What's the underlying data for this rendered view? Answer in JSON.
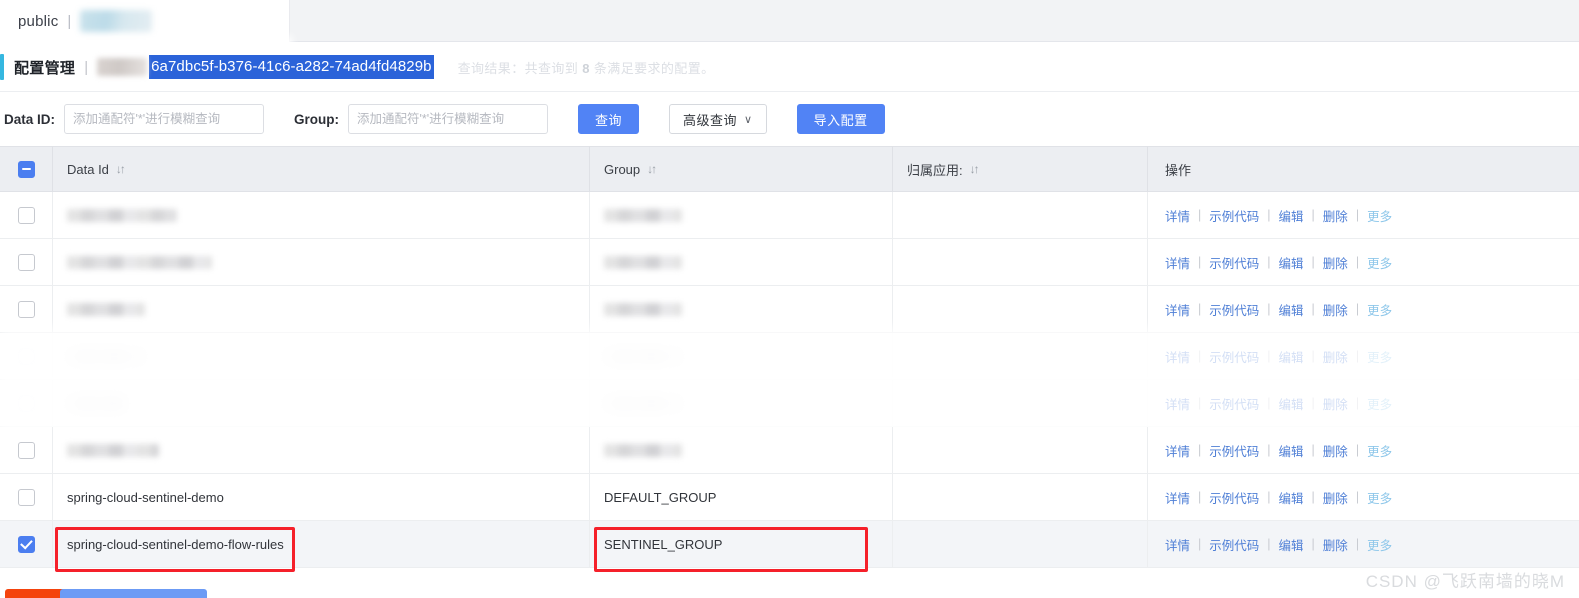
{
  "tab": {
    "namespace_label": "public",
    "separator": "|",
    "redacted_icon": "blurred-namespace-chip"
  },
  "header": {
    "title": "配置管理",
    "separator": "|",
    "redacted_prefix": "blurred-tenant-name",
    "selected_namespace_id": "6a7dbc5f-b376-41c6-a282-74ad4fd4829b",
    "query_result_prefix": "查询结果：共查询到",
    "query_result_count": "8",
    "query_result_suffix": "条满足要求的配置。",
    "accent_color": "#35b7e0",
    "selection_color": "#2b63d9"
  },
  "search": {
    "data_id_label": "Data ID:",
    "data_id_value": "",
    "data_id_placeholder": "添加通配符'*'进行模糊查询",
    "group_label": "Group:",
    "group_value": "",
    "group_placeholder": "添加通配符'*'进行模糊查询",
    "query_button": "查询",
    "advanced_button": "高级查询",
    "advanced_caret": "∨",
    "import_button": "导入配置",
    "primary_color": "#5183f5"
  },
  "table": {
    "columns": [
      {
        "label": "Data Id",
        "sort": "↓↑"
      },
      {
        "label": "Group",
        "sort": "↓↑"
      },
      {
        "label": "归属应用:",
        "sort": "↓↑"
      },
      {
        "label": "操作",
        "sort": ""
      }
    ],
    "header_checkbox_state": "indeterminate",
    "actions": {
      "detail": "详情",
      "sample_code": "示例代码",
      "edit": "编辑",
      "delete": "删除",
      "more": "更多",
      "divider": "|"
    },
    "rows": [
      {
        "checked": false,
        "redacted": true,
        "data_id": "",
        "group": "",
        "app": "",
        "style": "normal"
      },
      {
        "checked": false,
        "redacted": true,
        "data_id": "",
        "group": "",
        "app": "",
        "style": "normal"
      },
      {
        "checked": false,
        "redacted": true,
        "data_id": "",
        "group": "",
        "app": "",
        "style": "normal"
      },
      {
        "checked": false,
        "redacted": true,
        "data_id": "",
        "group": "",
        "app": "",
        "style": "smeared"
      },
      {
        "checked": false,
        "redacted": true,
        "data_id": "",
        "group": "",
        "app": "",
        "style": "smeared"
      },
      {
        "checked": false,
        "redacted": true,
        "data_id": "",
        "group": "",
        "app": "",
        "style": "normal"
      },
      {
        "checked": false,
        "redacted": false,
        "data_id": "spring-cloud-sentinel-demo",
        "group": "DEFAULT_GROUP",
        "app": "",
        "style": "normal"
      },
      {
        "checked": true,
        "redacted": false,
        "data_id": "spring-cloud-sentinel-demo-flow-rules",
        "group": "SENTINEL_GROUP",
        "app": "",
        "style": "selected"
      }
    ]
  },
  "annotations": {
    "highlight_color": "#f5202a",
    "boxes": [
      "data-id-highlight",
      "group-highlight"
    ]
  },
  "bottom_buttons": [
    {
      "name": "delete-selected-button",
      "color": "#f4430d"
    },
    {
      "name": "export-selected-button",
      "color": "#6c9bf5"
    },
    {
      "name": "clone-button",
      "color": "#6c9bf5"
    }
  ],
  "watermark": {
    "text": "CSDN @飞跃南墙的晓M"
  }
}
